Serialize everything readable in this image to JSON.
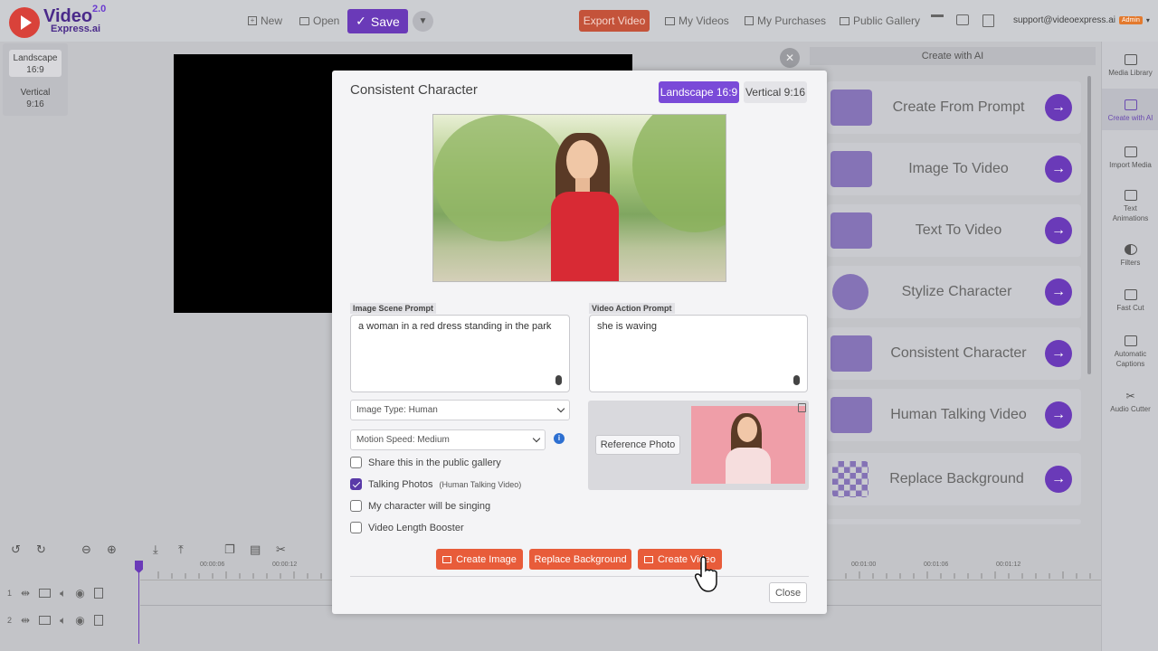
{
  "app": {
    "logo_text_1": "Video",
    "logo_text_2": "Express.ai",
    "logo_version": "2.0"
  },
  "topbar": {
    "new_label": "New",
    "open_label": "Open",
    "save_label": "Save",
    "export_label": "Export Video",
    "my_videos": "My Videos",
    "my_purchases": "My Purchases",
    "public_gallery": "Public Gallery",
    "email": "support@videoexpress.ai",
    "admin_badge": "Admin"
  },
  "leftpanel": {
    "landscape_1": "Landscape",
    "landscape_2": "16:9",
    "vertical_1": "Vertical",
    "vertical_2": "9:16"
  },
  "ai_panel": {
    "header": "Create with AI",
    "items": [
      {
        "label": "Create From Prompt",
        "icon": "clapper-icon"
      },
      {
        "label": "Image To Video",
        "icon": "camera-image-icon"
      },
      {
        "label": "Text To Video",
        "icon": "camera-text-icon"
      },
      {
        "label": "Stylize Character",
        "icon": "face-icon"
      },
      {
        "label": "Consistent Character",
        "icon": "people-icon"
      },
      {
        "label": "Human Talking Video",
        "icon": "speaking-person-icon"
      },
      {
        "label": "Replace Background",
        "icon": "checker-icon"
      }
    ]
  },
  "right_sidebar": {
    "items": [
      {
        "label": "Media Library"
      },
      {
        "label": "Create with AI"
      },
      {
        "label": "Import Media"
      },
      {
        "label": "Text Animations"
      },
      {
        "label": "Filters"
      },
      {
        "label": "Fast Cut"
      },
      {
        "label": "Automatic Captions"
      },
      {
        "label": "Audio Cutter"
      }
    ]
  },
  "timeline": {
    "ticks": [
      "00:00:06",
      "00:00:12",
      "00:01:00",
      "00:01:06",
      "00:01:12"
    ],
    "track_numbers": [
      "1",
      "2"
    ]
  },
  "modal": {
    "title": "Consistent Character",
    "landscape_label": "Landscape 16:9",
    "vertical_label": "Vertical 9:16",
    "image_prompt_label": "Image Scene Prompt",
    "image_prompt_value": "a woman in a red dress standing in the park",
    "video_prompt_label": "Video Action Prompt",
    "video_prompt_value": "she is waving",
    "image_type": "Image Type: Human",
    "motion_speed": "Motion Speed: Medium",
    "reference_photo": "Reference Photo",
    "checkboxes": [
      {
        "label": "Share this in the public gallery",
        "checked": false,
        "note": ""
      },
      {
        "label": "Talking Photos",
        "checked": true,
        "note": "(Human Talking Video)"
      },
      {
        "label": "My character will be singing",
        "checked": false,
        "note": ""
      },
      {
        "label": "Video Length Booster",
        "checked": false,
        "note": ""
      }
    ],
    "create_image": "Create Image",
    "replace_background": "Replace Background",
    "create_video": "Create Video",
    "close": "Close"
  },
  "colors": {
    "accent": "#6a3ab8",
    "export": "#c4533a",
    "action": "#e85c3a"
  }
}
